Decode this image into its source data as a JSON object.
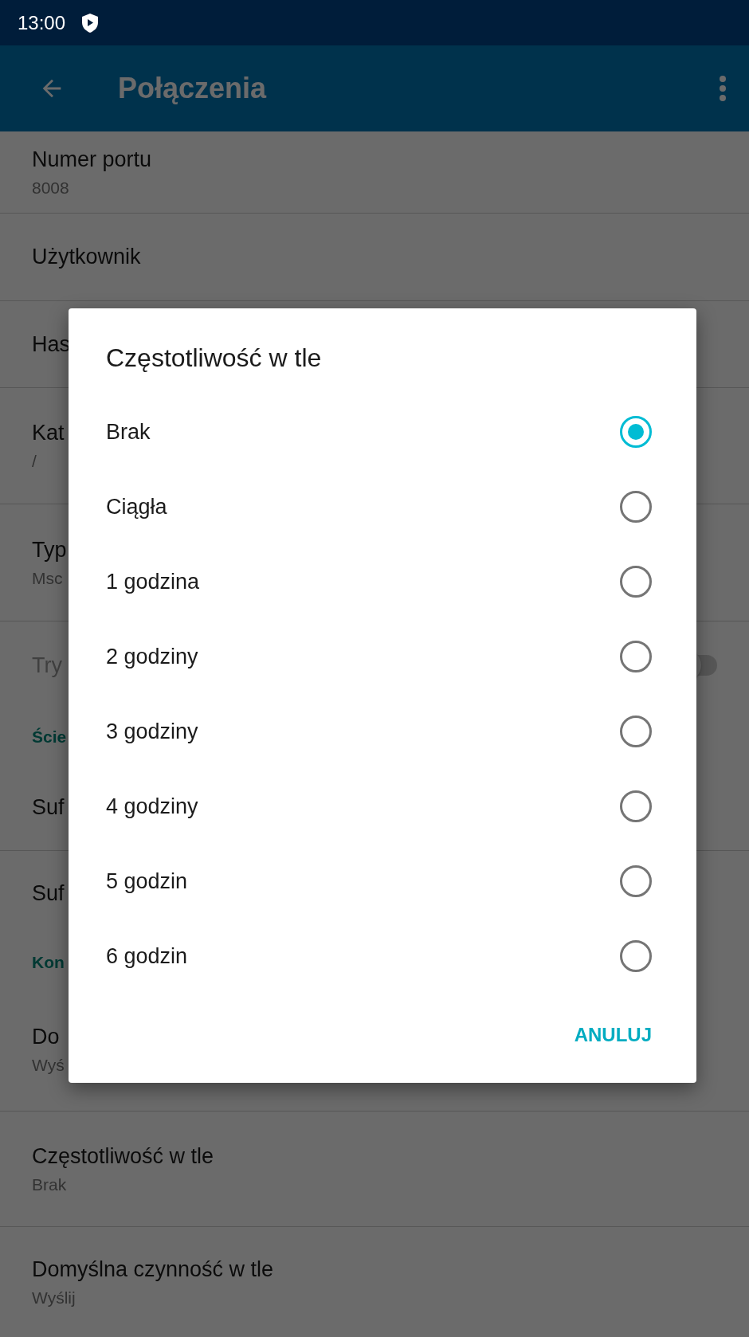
{
  "status_bar": {
    "time": "13:00"
  },
  "app_bar": {
    "title": "Połączenia"
  },
  "settings": [
    {
      "kind": "item",
      "title": "Numer portu",
      "summary": "8008"
    },
    {
      "kind": "item",
      "title": "Użytkownik"
    },
    {
      "kind": "item",
      "title": "Has"
    },
    {
      "kind": "item",
      "title": "Kat",
      "summary": "/"
    },
    {
      "kind": "item",
      "title": "Typ",
      "summary": "Msc"
    },
    {
      "kind": "switch",
      "title": "Try",
      "disabled": true,
      "on": false
    },
    {
      "kind": "header",
      "title": "Ście"
    },
    {
      "kind": "item",
      "title": "Suf"
    },
    {
      "kind": "item",
      "title": "Suf"
    },
    {
      "kind": "header",
      "title": "Kon"
    },
    {
      "kind": "item",
      "title": "Do",
      "summary": "Wyś"
    },
    {
      "kind": "item",
      "title": "Częstotliwość w tle",
      "summary": "Brak"
    },
    {
      "kind": "item",
      "title": "Domyślna czynność w tle",
      "summary": "Wyślij"
    }
  ],
  "dialog": {
    "title": "Częstotliwość w tle",
    "options": [
      {
        "label": "Brak",
        "selected": true
      },
      {
        "label": "Ciągła",
        "selected": false
      },
      {
        "label": "1 godzina",
        "selected": false
      },
      {
        "label": "2 godziny",
        "selected": false
      },
      {
        "label": "3 godziny",
        "selected": false
      },
      {
        "label": "4 godziny",
        "selected": false
      },
      {
        "label": "5 godzin",
        "selected": false
      },
      {
        "label": "6 godzin",
        "selected": false
      }
    ],
    "buttons": [
      "ANULUJ"
    ]
  }
}
